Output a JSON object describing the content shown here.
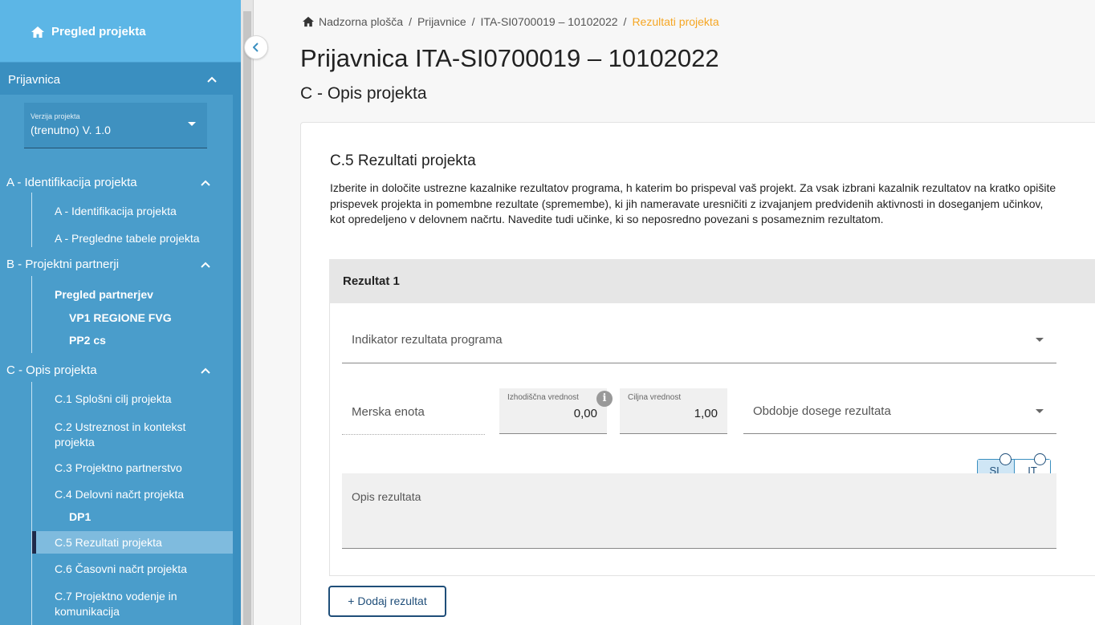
{
  "sidebar": {
    "home_label": "Pregled projekta",
    "prijavnica_label": "Prijavnica",
    "version_label": "Verzija projekta",
    "version_value": "(trenutno) V. 1.0",
    "section_a": {
      "title": "A - Identifikacija projekta",
      "items": [
        "A - Identifikacija projekta",
        "A - Pregledne tabele projekta"
      ]
    },
    "section_b": {
      "title": "B - Projektni partnerji",
      "items": [
        "Pregled partnerjev",
        "VP1 REGIONE FVG",
        "PP2 cs"
      ]
    },
    "section_c": {
      "title": "C - Opis projekta",
      "items": [
        "C.1 Splošni cilj projekta",
        "C.2 Ustreznost in kontekst projekta",
        "C.3 Projektno partnerstvo",
        "C.4 Delovni načrt projekta",
        "DP1",
        "C.5 Rezultati projekta",
        "C.6 Časovni načrt projekta",
        "C.7 Projektno vodenje in komunikacija"
      ]
    }
  },
  "breadcrumb": {
    "items": [
      "Nadzorna plošča",
      "Prijavnice",
      "ITA-SI0700019 – 10102022"
    ],
    "current": "Rezultati projekta"
  },
  "page": {
    "title": "Prijavnica ITA-SI0700019 – 10102022",
    "subtitle": "C - Opis projekta"
  },
  "section": {
    "title": "C.5 Rezultati projekta",
    "description": "Izberite in določite ustrezne kazalnike rezultatov programa, h katerim bo prispeval vaš projekt. Za vsak izbrani kazalnik rezultatov na kratko opišite prispevek projekta in pomembne rezultate (spremembe), ki jih nameravate uresničiti z izvajanjem predvidenih aktivnosti in doseganjem učinkov, kot opredeljeno v delovnem načrtu. Navedite tudi učinke, ki so neposredno povezani s posameznim rezultatom."
  },
  "result": {
    "header": "Rezultat 1",
    "indicator_placeholder": "Indikator rezultata programa",
    "unit_label": "Merska enota",
    "baseline_label": "Izhodiščna vrednost",
    "baseline_value": "0,00",
    "target_label": "Ciljna vrednost",
    "target_value": "1,00",
    "period_placeholder": "Obdobje dosege rezultata",
    "lang_sl": "SL",
    "lang_it": "IT",
    "description_placeholder": "Opis rezultata"
  },
  "add_button": "+ Dodaj rezultat",
  "colors": {
    "sidebar_bg": "#3a8fc0",
    "sidebar_home": "#5cb6e6",
    "breadcrumb_current": "#f6a623",
    "button_accent": "#1f4e79"
  }
}
